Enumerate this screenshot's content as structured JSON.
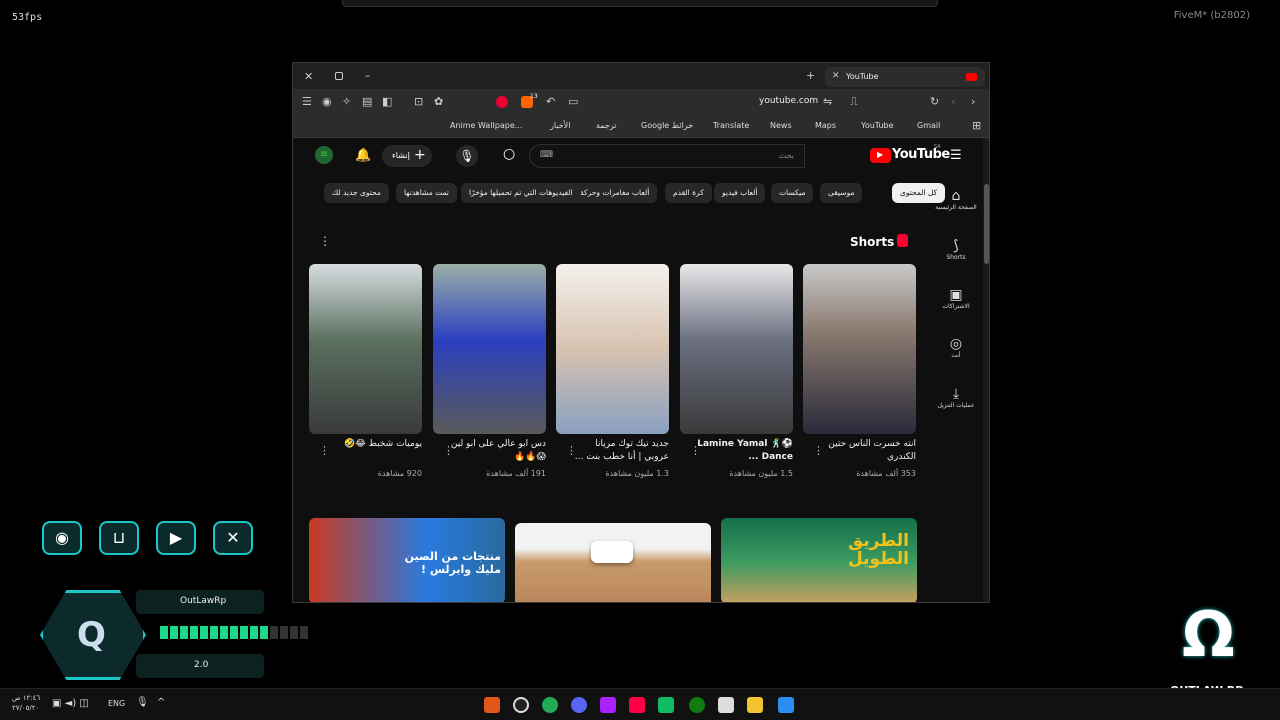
{
  "overlay": {
    "fps": "53fps",
    "fivem": "FiveM* (b2802)"
  },
  "browser": {
    "tab_title": "YouTube",
    "url": "youtube.com",
    "badges": {
      "brave_count": "13"
    },
    "bookmarks": [
      "Anime Wallpape...",
      "الأخبار",
      "ترجمة",
      "Google خرائط",
      "Translate",
      "News",
      "Maps",
      "YouTube",
      "Gmail"
    ]
  },
  "youtube": {
    "logo": "YouTube",
    "country": "SA",
    "search_placeholder": "بحث",
    "create_label": "إنشاء",
    "chips": [
      "كل المحتوى",
      "موسيقى",
      "ميكسات",
      "ألعاب فيديو",
      "كرة القدم",
      "ألعاب مغامرات وحركة",
      "الفيديوهات التي تم تحميلها مؤخرًا",
      "تمت مشاهدتها",
      "محتوى جديد لك"
    ],
    "sidebar": [
      {
        "label": "الصفحة الرئيسية",
        "icon": "home-icon"
      },
      {
        "label": "Shorts",
        "icon": "shorts-icon"
      },
      {
        "label": "الاشتراكات",
        "icon": "subscriptions-icon"
      },
      {
        "label": "أنت",
        "icon": "you-icon"
      },
      {
        "label": "عمليات التنزيل",
        "icon": "download-icon"
      }
    ],
    "shorts_title": "Shorts",
    "shorts": [
      {
        "title": "انته خسرت الناس حتين الكندري",
        "views": "353 ألف مشاهدة"
      },
      {
        "title": "Lamine Yamal 🕺⚽ Dance ...",
        "views": "1.5 مليون مشاهدة"
      },
      {
        "title": "جديد تيك توك مريانا عروبي | أنا خطب بنت ...",
        "views": "1.3 مليون مشاهدة"
      },
      {
        "title": "دس ابو عالي على ابو لين 😱🔥🔥",
        "views": "191 ألف مشاهدة"
      },
      {
        "title": "يوميات شخبط 😂🤣",
        "views": "920 مشاهدة"
      }
    ],
    "videos": [
      {
        "overlay_text": "الطريق الطويل"
      },
      {
        "overlay_text": ""
      },
      {
        "overlay_text": "منتجات من الصين مليك وايرلس !"
      }
    ]
  },
  "hud": {
    "server": "OutLawRp",
    "version": "2.0",
    "logo": "OUTLAW RP",
    "bar_fill": 0.7
  },
  "taskbar": {
    "lang": "ENG",
    "time": "١٢:٤٦ ص",
    "date": "٢٧/٠٥/٢٠"
  }
}
